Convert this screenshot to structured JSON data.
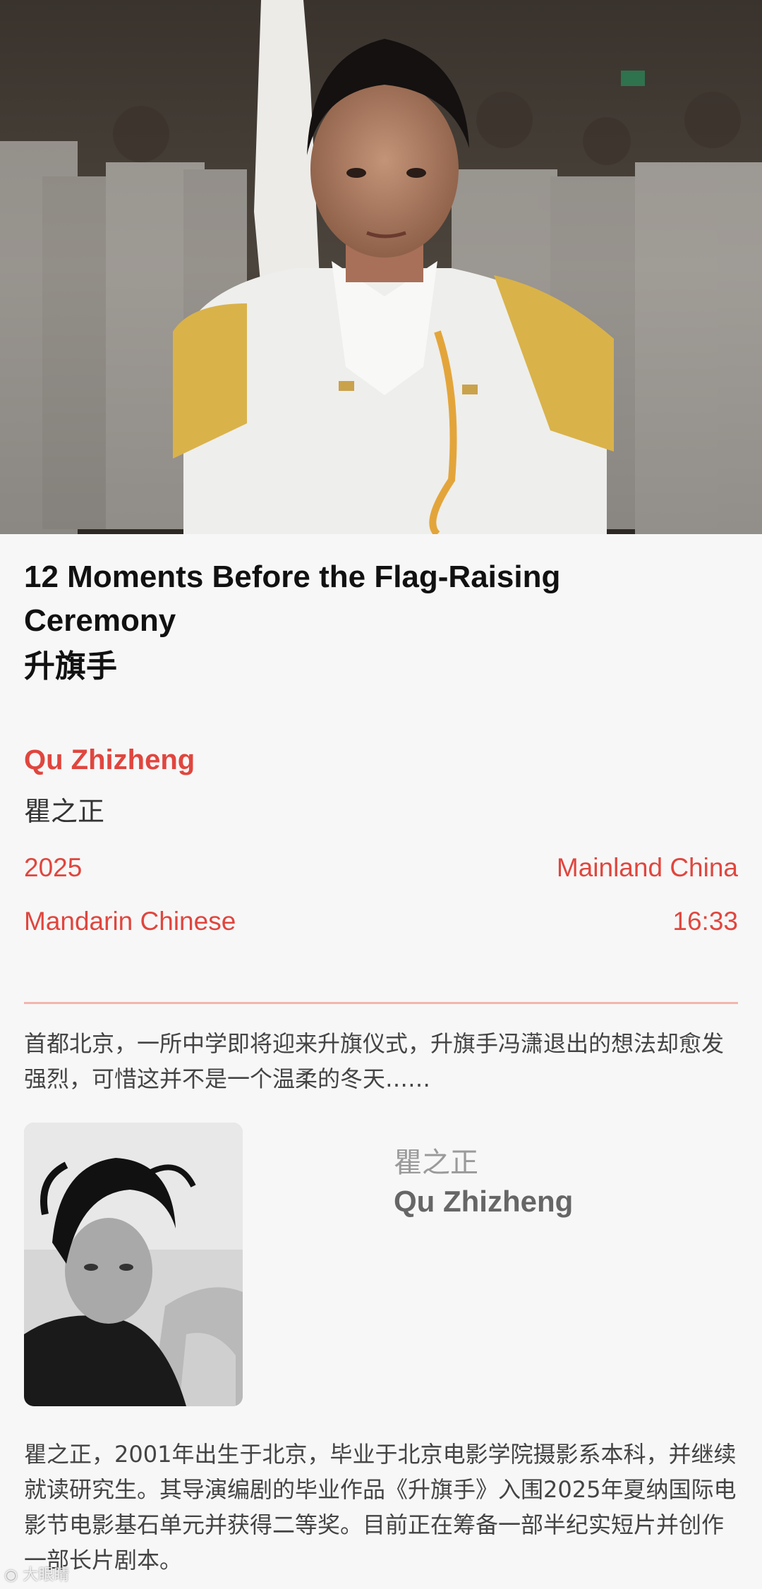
{
  "hero": {
    "image_name": "film-still-flag-bearer"
  },
  "film": {
    "title_en": "12 Moments Before the Flag-Raising Ceremony",
    "title_zh": "升旗手"
  },
  "director": {
    "name_en": "Qu Zhizheng",
    "name_zh": "瞿之正"
  },
  "meta": {
    "year": "2025",
    "region": "Mainland China",
    "language": "Mandarin Chinese",
    "duration": "16:33"
  },
  "synopsis": "首都北京，一所中学即将迎来升旗仪式，升旗手冯潇退出的想法却愈发强烈，可惜这并不是一个温柔的冬天……",
  "bio_card": {
    "portrait_name": "director-portrait",
    "name_zh": "瞿之正",
    "name_en": "Qu Zhizheng"
  },
  "bio": "瞿之正，2001年出生于北京，毕业于北京电影学院摄影系本科，并继续就读研究生。其导演编剧的毕业作品《升旗手》入围2025年夏纳国际电影节电影基石单元并获得二等奖。目前正在筹备一部半纪实短片并创作一部长片剧本。",
  "watermark": "大眼睛",
  "colors": {
    "accent": "#e0463e",
    "divider": "#f2b6ad",
    "background": "#f7f7f7"
  }
}
